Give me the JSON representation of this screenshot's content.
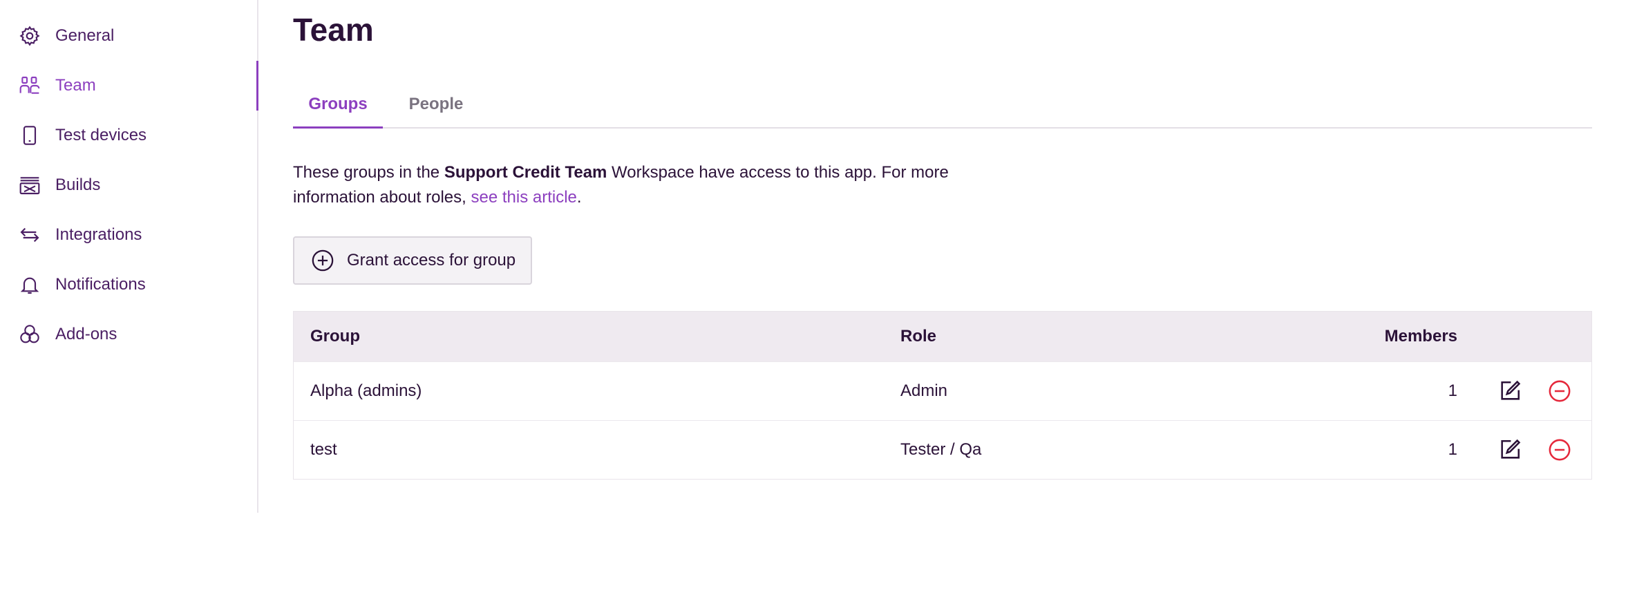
{
  "sidebar": {
    "items": [
      {
        "label": "General",
        "icon": "gear-icon"
      },
      {
        "label": "Team",
        "icon": "users-icon",
        "active": true
      },
      {
        "label": "Test devices",
        "icon": "phone-icon"
      },
      {
        "label": "Builds",
        "icon": "builds-icon"
      },
      {
        "label": "Integrations",
        "icon": "arrows-icon"
      },
      {
        "label": "Notifications",
        "icon": "bell-icon"
      },
      {
        "label": "Add-ons",
        "icon": "addons-icon"
      }
    ]
  },
  "page": {
    "title": "Team"
  },
  "tabs": [
    {
      "label": "Groups",
      "active": true
    },
    {
      "label": "People",
      "active": false
    }
  ],
  "description": {
    "pre": "These groups in the ",
    "workspace": "Support Credit Team",
    "mid": " Workspace have access to this app. For more information about roles, ",
    "link": "see this article",
    "post": "."
  },
  "grant_button": {
    "label": "Grant access for group",
    "icon": "plus-circle-icon"
  },
  "table": {
    "columns": {
      "group": "Group",
      "role": "Role",
      "members": "Members"
    },
    "rows": [
      {
        "group": "Alpha (admins)",
        "role": "Admin",
        "members": "1"
      },
      {
        "group": "test",
        "role": "Tester / Qa",
        "members": "1"
      }
    ]
  },
  "colors": {
    "accent": "#8c3fbf",
    "text": "#2b1238",
    "danger": "#e5283b",
    "header_bg": "#efeaf0"
  }
}
